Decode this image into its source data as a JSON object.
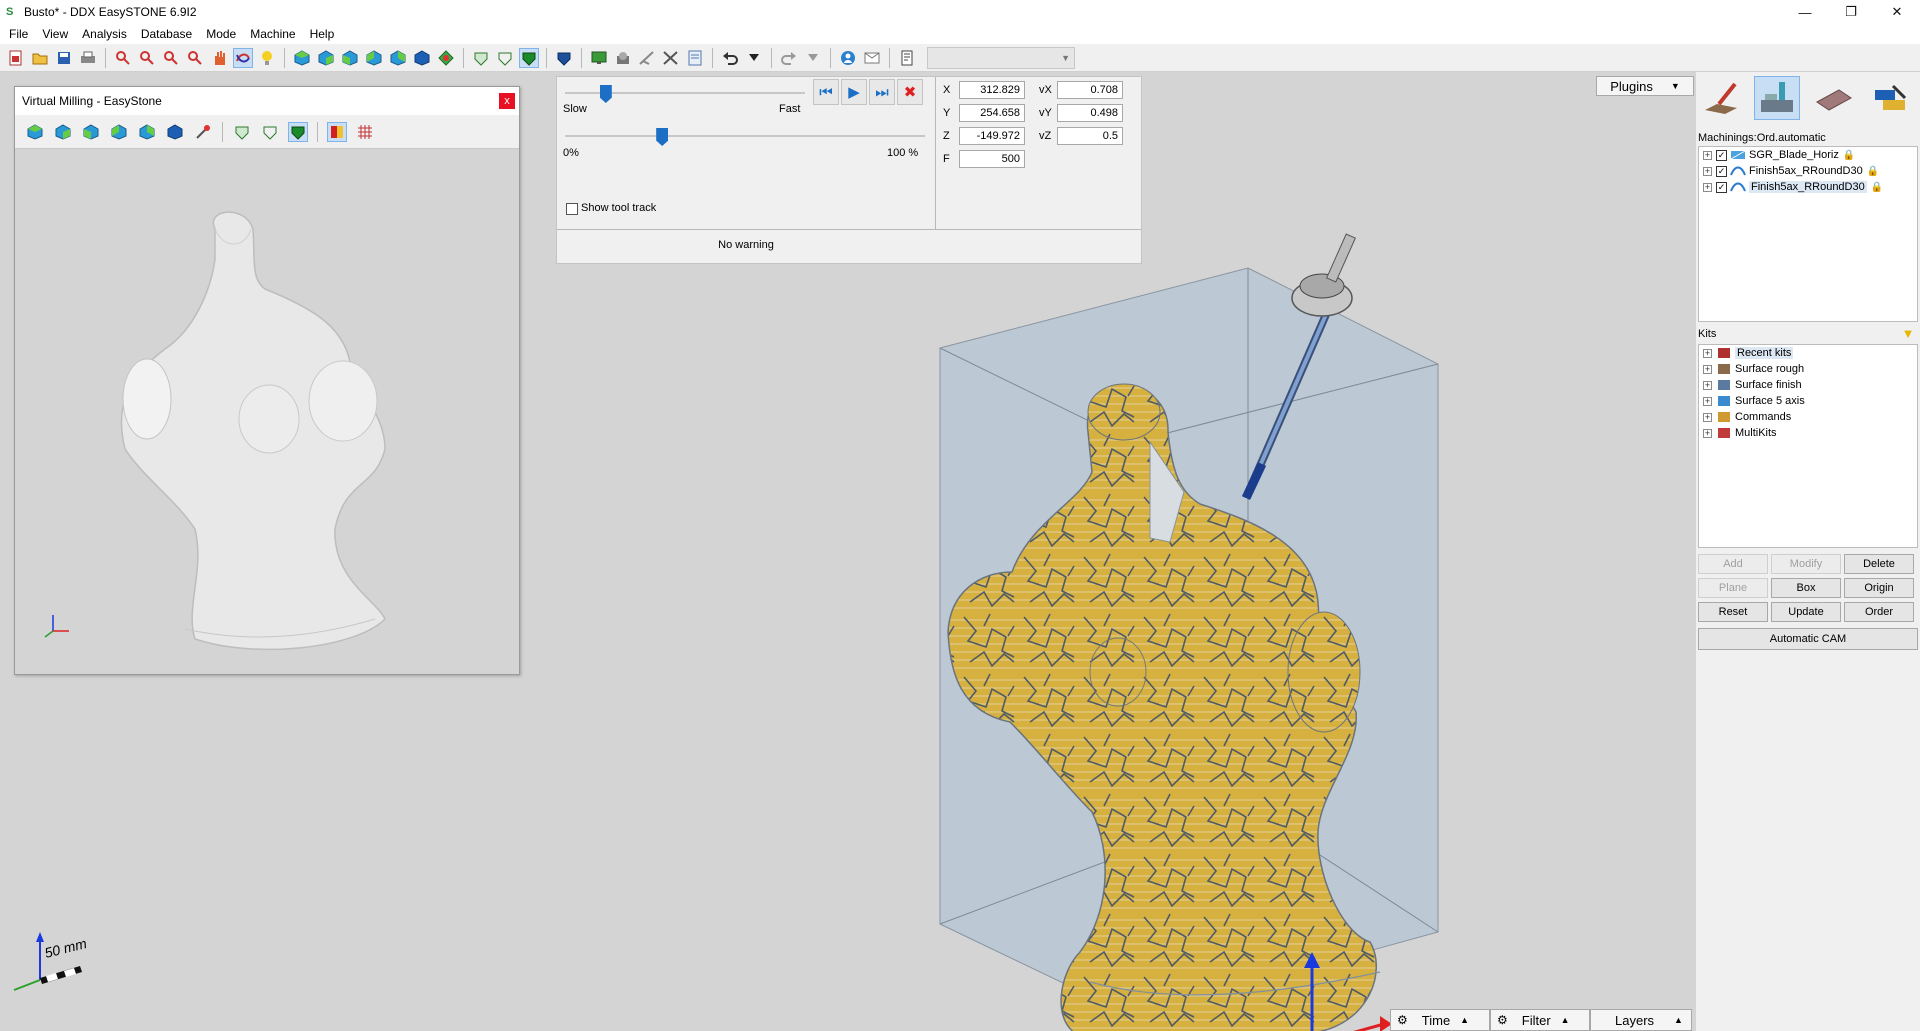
{
  "window": {
    "title": "Busto* - DDX EasySTONE 6.9I2",
    "app_icon": "S"
  },
  "window_controls": {
    "minimize": "—",
    "maximize": "❐",
    "close": "✕"
  },
  "menu": [
    "File",
    "View",
    "Analysis",
    "Database",
    "Mode",
    "Machine",
    "Help"
  ],
  "virtual_milling": {
    "title": "Virtual Milling - EasyStone",
    "close": "x"
  },
  "simulation": {
    "slow_label": "Slow",
    "fast_label": "Fast",
    "progress_start_label": "0%",
    "progress_end_label": "100 %",
    "speed_level": 0.17,
    "progress_level": 0.27,
    "show_tool_track_label": "Show tool track",
    "show_tool_track_checked": false,
    "warning": "No warning",
    "nav": {
      "first": "⏮",
      "play": "▶",
      "last": "⏭",
      "stop": "✖"
    }
  },
  "coordinates": {
    "x_label": "X",
    "x_value": "312.829",
    "y_label": "Y",
    "y_value": "254.658",
    "z_label": "Z",
    "z_value": "-149.972",
    "f_label": "F",
    "f_value": "500",
    "vx_label": "vX",
    "vx_value": "0.708",
    "vy_label": "vY",
    "vy_value": "0.498",
    "vz_label": "vZ",
    "vz_value": "0.5"
  },
  "plugins": {
    "label": "Plugins",
    "caret": "▼"
  },
  "machinings": {
    "label": "Machinings:Ord.automatic",
    "items": [
      {
        "label": "SGR_Blade_Horiz",
        "checked": true
      },
      {
        "label": "Finish5ax_RRoundD30",
        "checked": true
      },
      {
        "label": "Finish5ax_RRoundD30",
        "checked": true
      }
    ]
  },
  "kits": {
    "label": "Kits",
    "items": [
      "Recent kits",
      "Surface rough",
      "Surface finish",
      "Surface 5 axis",
      "Commands",
      "MultiKits"
    ]
  },
  "buttons": {
    "add": "Add",
    "modify": "Modify",
    "delete": "Delete",
    "plane": "Plane",
    "box": "Box",
    "origin": "Origin",
    "reset": "Reset",
    "update": "Update",
    "order": "Order",
    "automatic_cam": "Automatic CAM"
  },
  "bottom": {
    "time": "Time",
    "filter": "Filter",
    "layers": "Layers"
  },
  "scale": {
    "label": "50 mm"
  },
  "colors": {
    "accent": "#1c6fc5",
    "part_fill": "#d7b13f",
    "stock_fill": "#b8c8d6",
    "toolpath": "#5b6672"
  }
}
